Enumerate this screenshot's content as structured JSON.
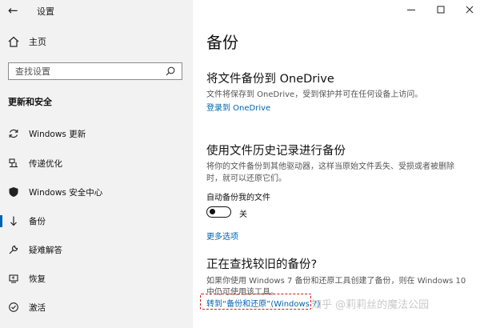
{
  "window": {
    "title": "设置",
    "controls": {
      "minimize": "—",
      "maximize": "☐",
      "close": "✕"
    }
  },
  "sidebar": {
    "home_label": "主页",
    "search_placeholder": "查找设置",
    "section_title": "更新和安全",
    "items": [
      {
        "label": "Windows 更新",
        "icon": "sync-icon",
        "active": false
      },
      {
        "label": "传递优化",
        "icon": "delivery-optimization-icon",
        "active": false
      },
      {
        "label": "Windows 安全中心",
        "icon": "shield-icon",
        "active": false
      },
      {
        "label": "备份",
        "icon": "backup-icon",
        "active": true
      },
      {
        "label": "疑难解答",
        "icon": "wrench-icon",
        "active": false
      },
      {
        "label": "恢复",
        "icon": "recovery-icon",
        "active": false
      },
      {
        "label": "激活",
        "icon": "activation-icon",
        "active": false
      }
    ]
  },
  "main": {
    "page_title": "备份",
    "onedrive": {
      "heading": "将文件备份到 OneDrive",
      "description": "文件将保存到 OneDrive，受到保护并可在任何设备上访问。",
      "link": "登录到 OneDrive"
    },
    "file_history": {
      "heading": "使用文件历史记录进行备份",
      "description_line1": "将你的文件备份到其他驱动器，这样当原始文件丢失、受损或者被删除",
      "description_line2": "时，就可以还原它们。",
      "auto_label": "自动备份我的文件",
      "toggle_state": "关",
      "more_link": "更多选项"
    },
    "older": {
      "heading": "正在查找较旧的备份?",
      "description_line1": "如果你使用 Windows 7 备份和还原工具创建了备份，则在 Windows 10",
      "description_line2": "中仍可使用该工具。",
      "link": "转到“备份和还原”(Windows 7)"
    }
  },
  "watermark": "知乎 @莉莉丝的魔法公园",
  "colors": {
    "accent": "#0063b1",
    "highlight_border": "#d11b1b",
    "sidebar_bg": "#f2f2f2"
  }
}
